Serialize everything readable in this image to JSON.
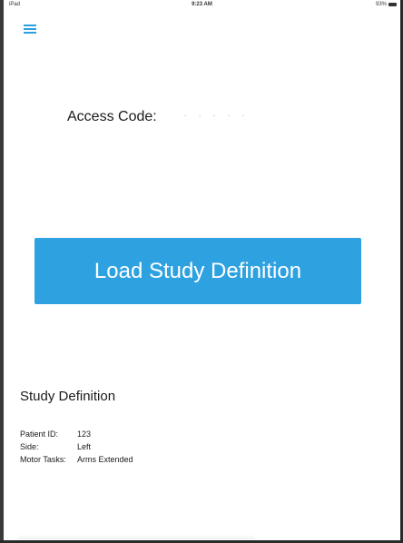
{
  "status_bar": {
    "carrier": "iPad",
    "time": "9:23 AM",
    "battery": "93%"
  },
  "access": {
    "label": "Access Code:",
    "value": "· · · · ·"
  },
  "load_button": {
    "label": "Load Study Definition"
  },
  "study": {
    "title": "Study Definition",
    "fields": [
      {
        "key": "Patient ID:",
        "value": "123"
      },
      {
        "key": "Side:",
        "value": "Left"
      },
      {
        "key": "Motor Tasks:",
        "value": "Arms Extended"
      }
    ]
  },
  "colors": {
    "accent": "#2ea2e0",
    "background": "#ffffff",
    "text": "#1a1a1a"
  },
  "icons": {
    "menu": "hamburger-menu-icon",
    "battery": "battery-icon"
  }
}
